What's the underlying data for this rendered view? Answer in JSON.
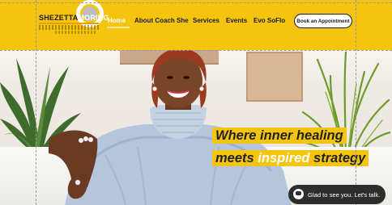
{
  "header": {
    "logo": {
      "name_part1": "SHEZETTA",
      "name_part2": "MORING"
    },
    "nav": [
      {
        "label": "Home",
        "active": true
      },
      {
        "label": "About Coach She"
      },
      {
        "label": "Services"
      },
      {
        "label": "Events"
      },
      {
        "label": "Evo SoFlo"
      }
    ],
    "cta_label": "Book an Appointment",
    "brand_color": "#f4c40f"
  },
  "hero": {
    "headline_line1": "Where inner healing",
    "headline_line2_pre": "meets ",
    "headline_line2_hl": "inspired",
    "headline_line2_post": " strategy"
  },
  "chat": {
    "label": "Glad to see you. Let's talk.",
    "icon": "chat-bubble-icon"
  }
}
